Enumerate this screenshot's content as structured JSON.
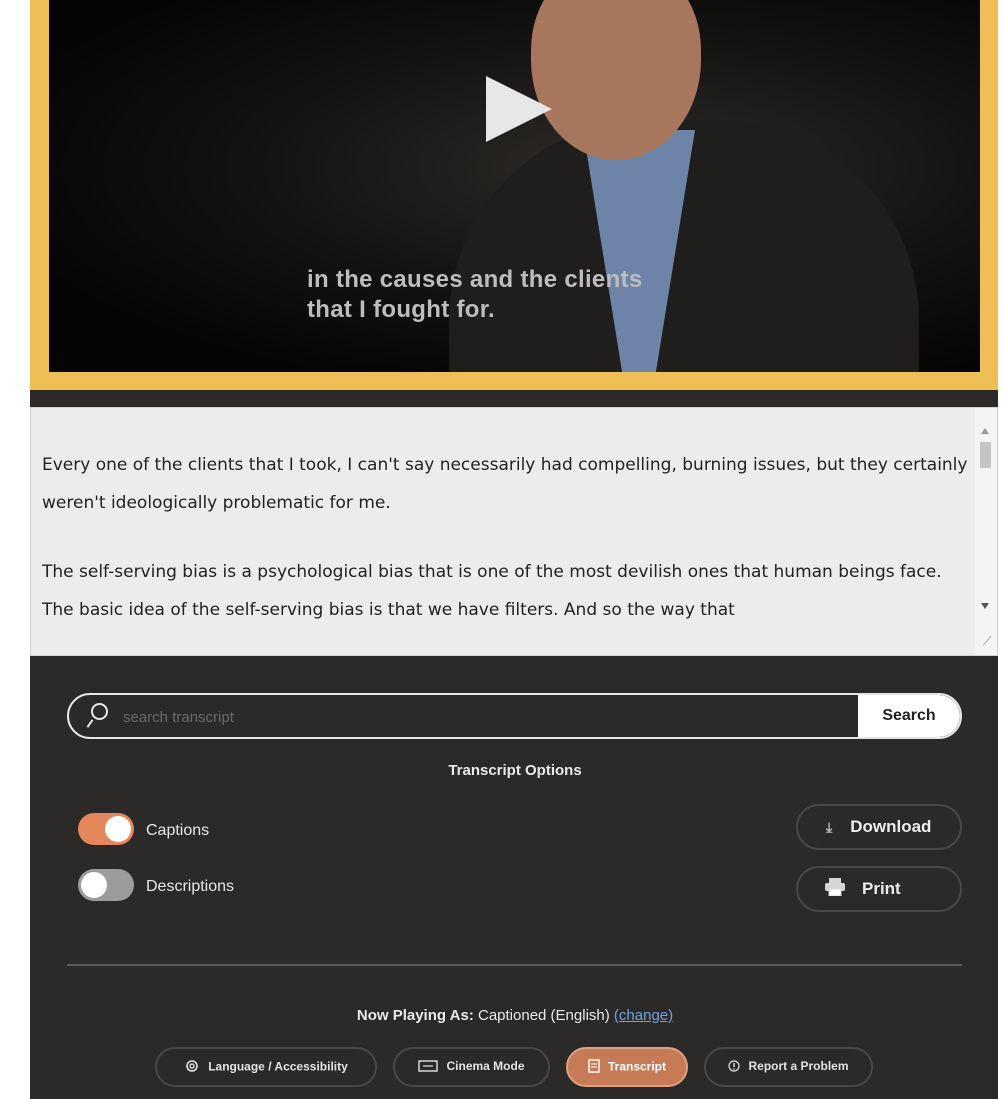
{
  "video": {
    "caption_line1": "in the causes and the clients",
    "caption_line2": "that I fought for.",
    "play_icon": "play-icon"
  },
  "transcript": {
    "paragraphs": [
      "Every one of the clients that I took, I can't say necessarily had compelling, burning issues, but they certainly weren't ideologically problematic for me.",
      "The self-serving bias is a psychological bias that is one of the most devilish ones that human beings face. The basic idea of the self-serving bias is that we have filters. And so the way that"
    ]
  },
  "search": {
    "placeholder": "search transcript",
    "button_label": "Search",
    "icon": "search-icon"
  },
  "options": {
    "title": "Transcript Options",
    "toggles": [
      {
        "label": "Captions",
        "on": true
      },
      {
        "label": "Descriptions",
        "on": false
      }
    ],
    "download_label": "Download",
    "print_label": "Print"
  },
  "now_playing": {
    "label": "Now Playing As:",
    "value": "Captioned (English)",
    "change_link": "(change)"
  },
  "bottom_buttons": [
    {
      "label": "Language / Accessibility",
      "icon": "gear-icon",
      "active": false
    },
    {
      "label": "Cinema Mode",
      "icon": "cinema-icon",
      "active": false
    },
    {
      "label": "Transcript",
      "icon": "transcript-icon",
      "active": true
    },
    {
      "label": "Report a Problem",
      "icon": "info-icon",
      "active": false
    }
  ],
  "colors": {
    "accent_gold": "#efbf55",
    "accent_orange": "#c77a56",
    "panel_dark": "#2c2a29",
    "link_blue": "#6aa6de"
  }
}
